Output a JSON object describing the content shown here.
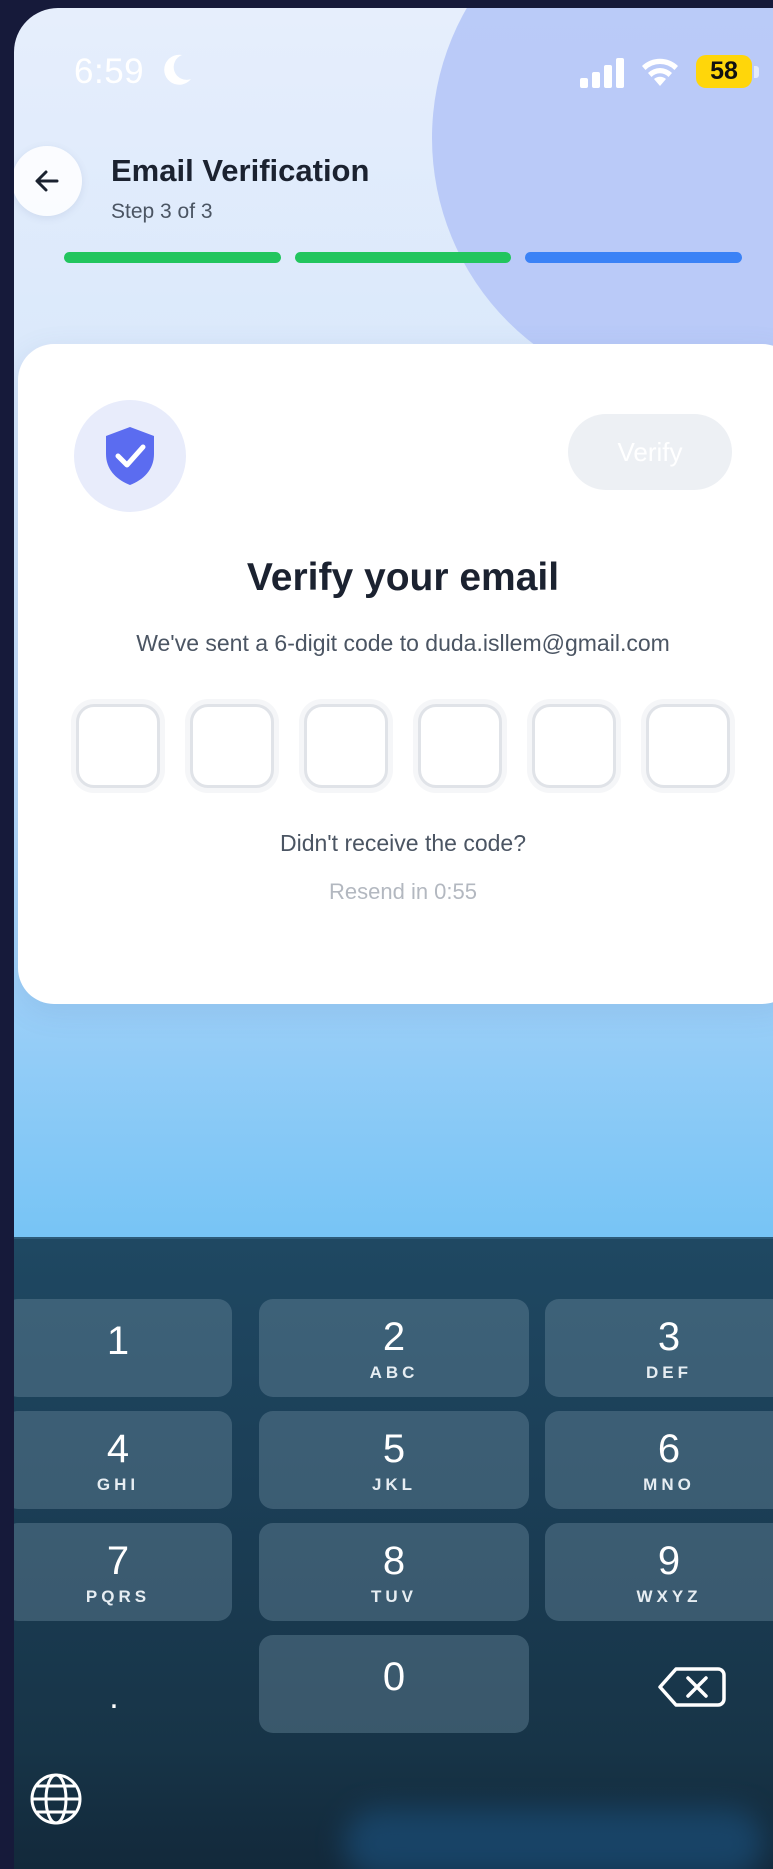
{
  "status_bar": {
    "time": "6:59",
    "battery": "58"
  },
  "header": {
    "title": "Email Verification",
    "step": "Step 3 of 3"
  },
  "progress": {
    "total_steps": 3,
    "current_step": 3,
    "colors": [
      "#22c55e",
      "#22c55e",
      "#3b82f6"
    ]
  },
  "card": {
    "verify_label": "Verify",
    "title": "Verify your email",
    "subtitle": "We've sent a 6-digit code to duda.isllem@gmail.com",
    "code_length": 6,
    "resend_question": "Didn't receive the code?",
    "resend_timer": "Resend in 0:55"
  },
  "keyboard": {
    "keys": [
      {
        "digit": "1",
        "letters": ""
      },
      {
        "digit": "2",
        "letters": "ABC"
      },
      {
        "digit": "3",
        "letters": "DEF"
      },
      {
        "digit": "4",
        "letters": "GHI"
      },
      {
        "digit": "5",
        "letters": "JKL"
      },
      {
        "digit": "6",
        "letters": "MNO"
      },
      {
        "digit": "7",
        "letters": "PQRS"
      },
      {
        "digit": "8",
        "letters": "TUV"
      },
      {
        "digit": "9",
        "letters": "WXYZ"
      },
      {
        "digit": "0",
        "letters": ""
      }
    ],
    "dot": "."
  },
  "colors": {
    "accent": "#5b6cf0",
    "progress_done": "#22c55e",
    "progress_current": "#3b82f6"
  },
  "icons": [
    "moon-icon",
    "signal-icon",
    "wifi-icon",
    "back-arrow-icon",
    "shield-check-icon",
    "backspace-icon",
    "globe-icon"
  ]
}
